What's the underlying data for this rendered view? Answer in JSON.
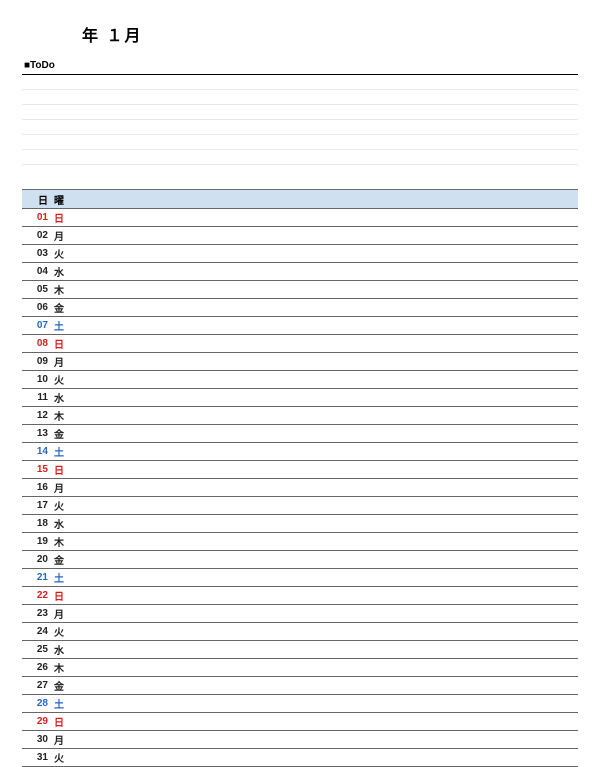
{
  "title": "年 １月",
  "todo": {
    "label": "■ToDo",
    "line_count": 6
  },
  "colors": {
    "header_bg": "#cfe0f0",
    "sunday": "#d62020",
    "saturday": "#2a66c4",
    "weekday": "#222222"
  },
  "calendar": {
    "headers": {
      "day": "日",
      "dow": "曜",
      "note": ""
    },
    "days": [
      {
        "num": "01",
        "dow": "日",
        "kind": "sun"
      },
      {
        "num": "02",
        "dow": "月",
        "kind": "wk"
      },
      {
        "num": "03",
        "dow": "火",
        "kind": "wk"
      },
      {
        "num": "04",
        "dow": "水",
        "kind": "wk"
      },
      {
        "num": "05",
        "dow": "木",
        "kind": "wk"
      },
      {
        "num": "06",
        "dow": "金",
        "kind": "wk"
      },
      {
        "num": "07",
        "dow": "土",
        "kind": "sat"
      },
      {
        "num": "08",
        "dow": "日",
        "kind": "sun"
      },
      {
        "num": "09",
        "dow": "月",
        "kind": "wk"
      },
      {
        "num": "10",
        "dow": "火",
        "kind": "wk"
      },
      {
        "num": "11",
        "dow": "水",
        "kind": "wk"
      },
      {
        "num": "12",
        "dow": "木",
        "kind": "wk"
      },
      {
        "num": "13",
        "dow": "金",
        "kind": "wk"
      },
      {
        "num": "14",
        "dow": "土",
        "kind": "sat"
      },
      {
        "num": "15",
        "dow": "日",
        "kind": "sun"
      },
      {
        "num": "16",
        "dow": "月",
        "kind": "wk"
      },
      {
        "num": "17",
        "dow": "火",
        "kind": "wk"
      },
      {
        "num": "18",
        "dow": "水",
        "kind": "wk"
      },
      {
        "num": "19",
        "dow": "木",
        "kind": "wk"
      },
      {
        "num": "20",
        "dow": "金",
        "kind": "wk"
      },
      {
        "num": "21",
        "dow": "土",
        "kind": "sat"
      },
      {
        "num": "22",
        "dow": "日",
        "kind": "sun"
      },
      {
        "num": "23",
        "dow": "月",
        "kind": "wk"
      },
      {
        "num": "24",
        "dow": "火",
        "kind": "wk"
      },
      {
        "num": "25",
        "dow": "水",
        "kind": "wk"
      },
      {
        "num": "26",
        "dow": "木",
        "kind": "wk"
      },
      {
        "num": "27",
        "dow": "金",
        "kind": "wk"
      },
      {
        "num": "28",
        "dow": "土",
        "kind": "sat"
      },
      {
        "num": "29",
        "dow": "日",
        "kind": "sun"
      },
      {
        "num": "30",
        "dow": "月",
        "kind": "wk"
      },
      {
        "num": "31",
        "dow": "火",
        "kind": "wk"
      }
    ]
  }
}
